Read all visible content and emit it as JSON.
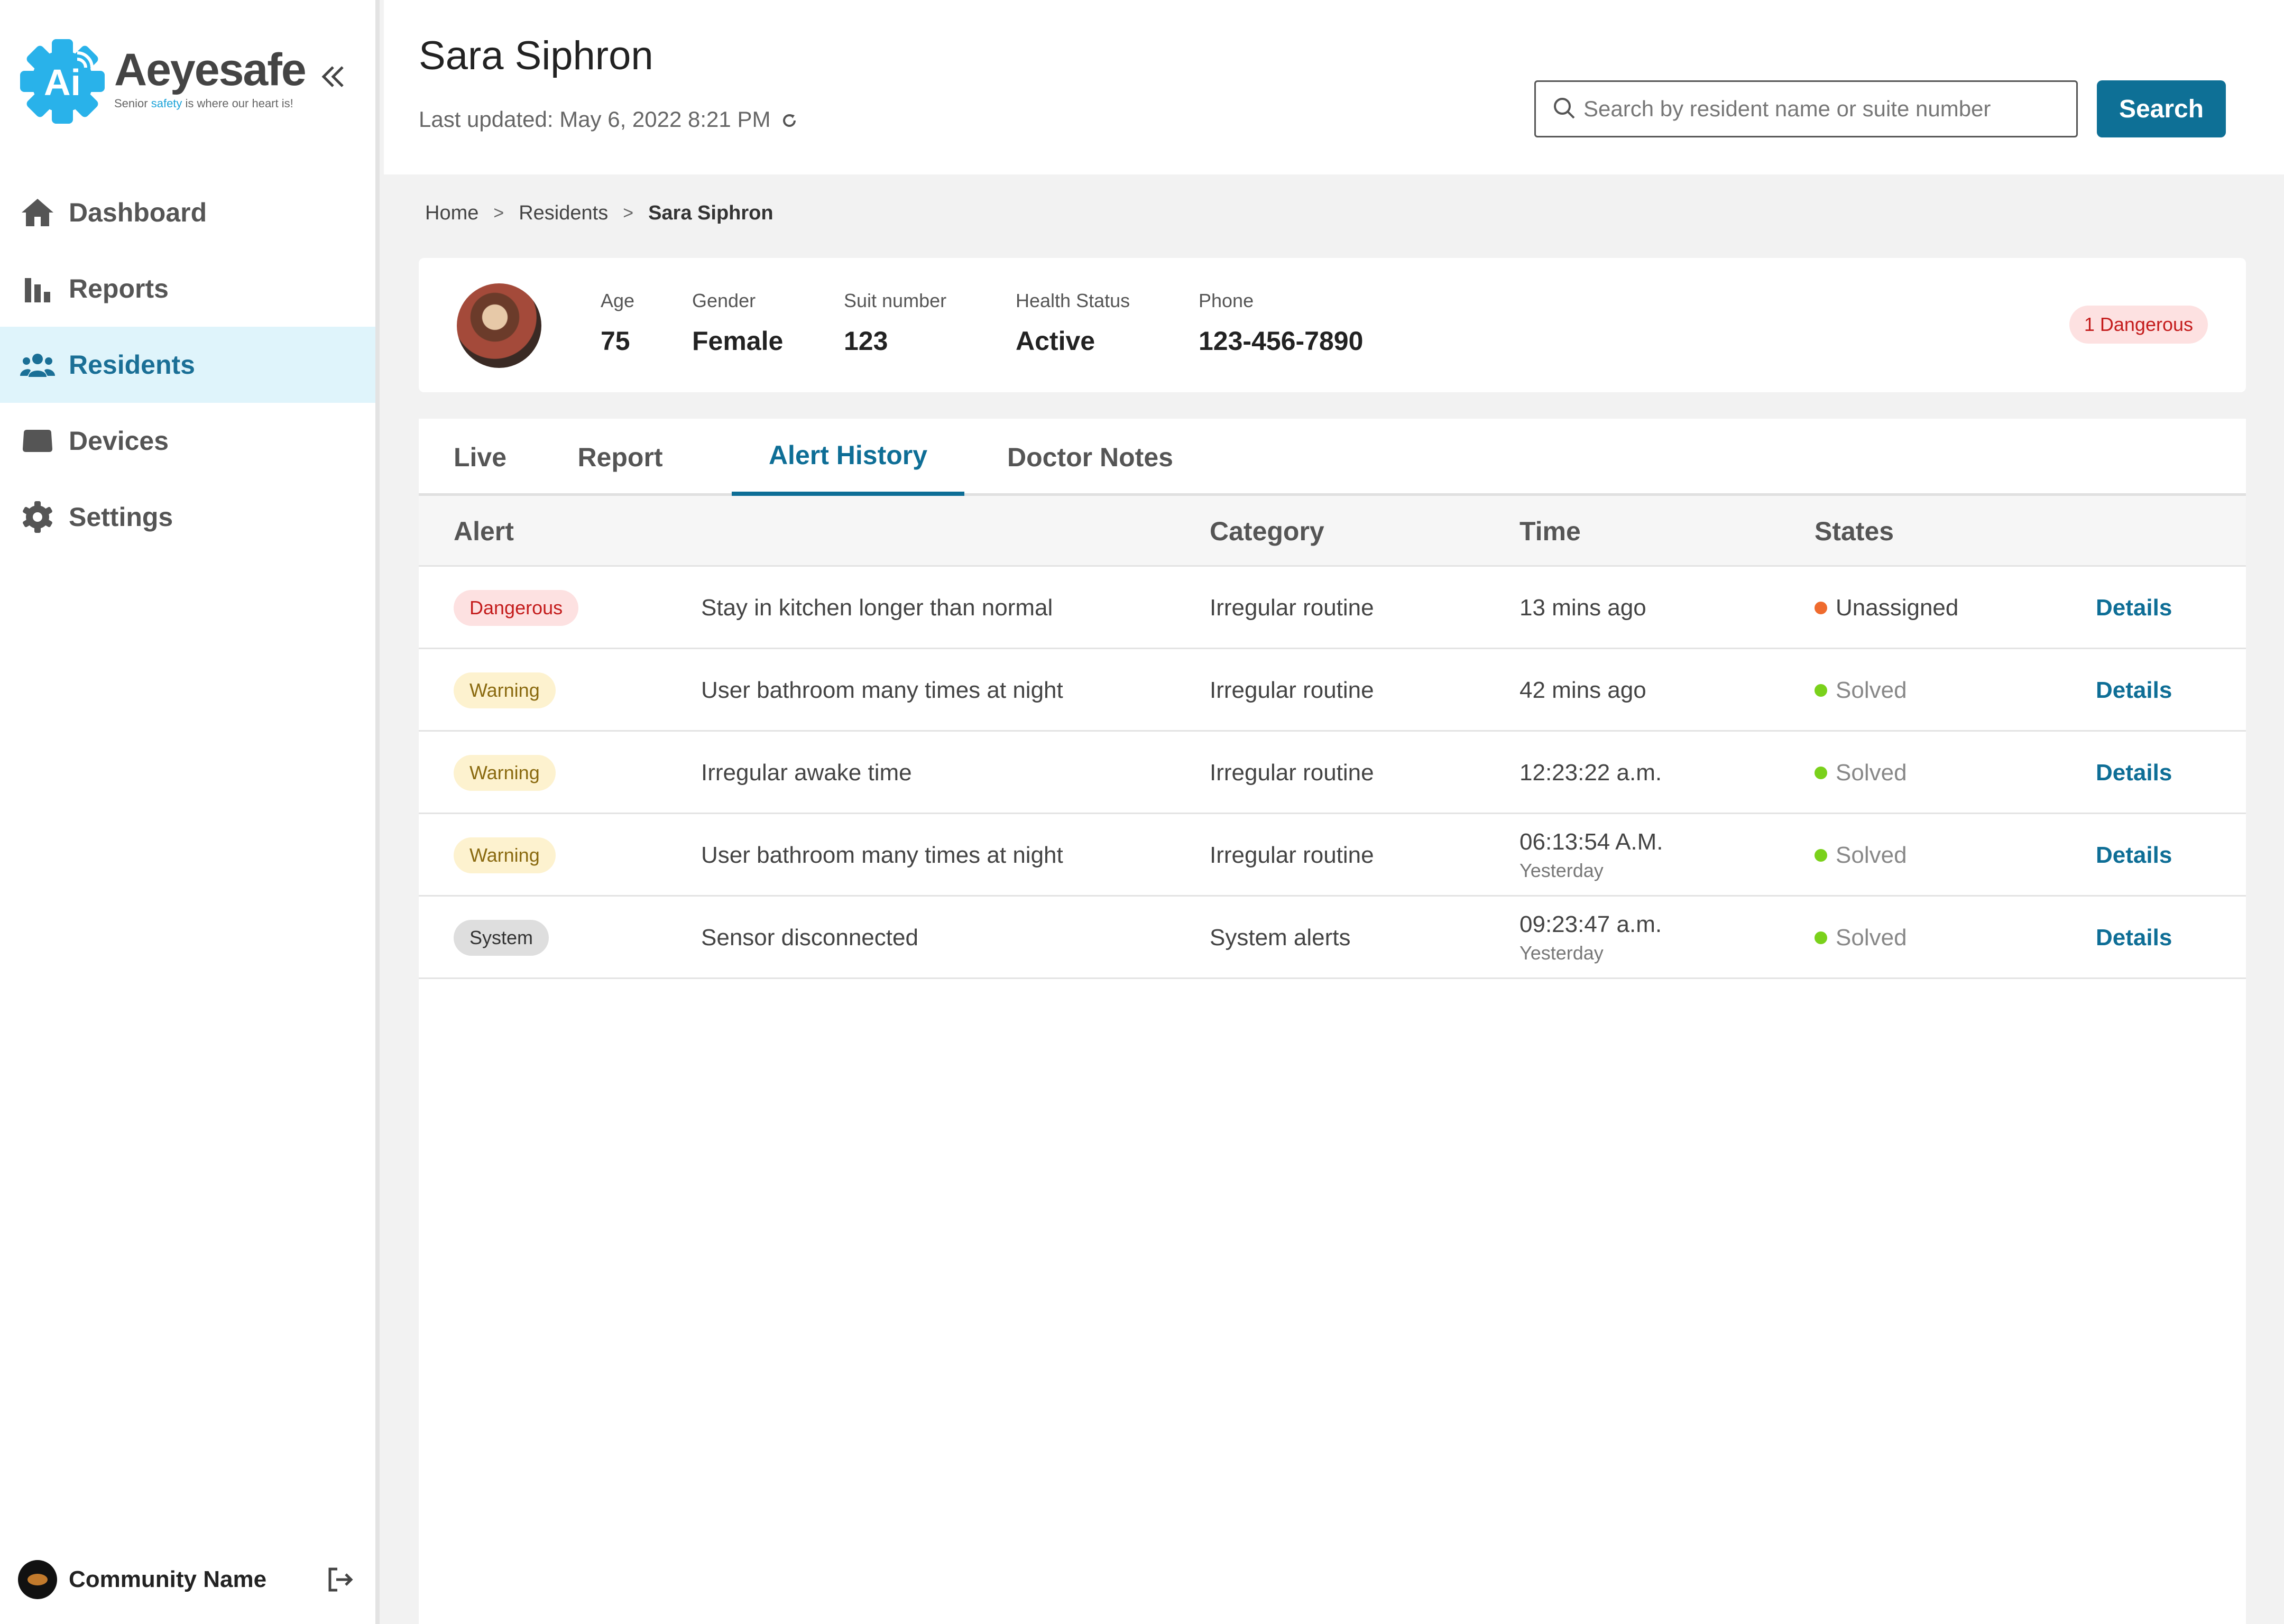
{
  "brand": {
    "name": "Aeyesafe",
    "mark_text": "Ai",
    "tagline_pre": "Senior ",
    "tagline_hl": "safety",
    "tagline_post": " is where our heart is!"
  },
  "sidebar": {
    "items": [
      {
        "label": "Dashboard",
        "icon": "home-icon",
        "active": false
      },
      {
        "label": "Reports",
        "icon": "bar-chart-icon",
        "active": false
      },
      {
        "label": "Residents",
        "icon": "people-icon",
        "active": true
      },
      {
        "label": "Devices",
        "icon": "device-icon",
        "active": false
      },
      {
        "label": "Settings",
        "icon": "gear-icon",
        "active": false
      }
    ],
    "community_name": "Community Name"
  },
  "header": {
    "title": "Sara Siphron",
    "last_updated": "Last updated: May 6, 2022 8:21 PM",
    "search_placeholder": "Search by resident name or suite number",
    "search_button": "Search"
  },
  "breadcrumb": [
    "Home",
    "Residents",
    "Sara Siphron"
  ],
  "profile": {
    "age_label": "Age",
    "age": "75",
    "gender_label": "Gender",
    "gender": "Female",
    "suit_label": "Suit number",
    "suit": "123",
    "health_label": "Health Status",
    "health": "Active",
    "phone_label": "Phone",
    "phone": "123-456-7890",
    "danger_badge": "1 Dangerous"
  },
  "tabs": [
    "Live",
    "Report",
    "Alert History",
    "Doctor Notes"
  ],
  "active_tab": "Alert History",
  "table": {
    "headers": {
      "alert": "Alert",
      "category": "Category",
      "time": "Time",
      "states": "States"
    },
    "rows": [
      {
        "level": "Dangerous",
        "level_type": "dangerous",
        "description": "Stay in kitchen longer than normal",
        "category": "Irregular routine",
        "time": "13 mins ago",
        "time_sub": "",
        "state": "Unassigned",
        "state_type": "unassigned",
        "action": "Details"
      },
      {
        "level": "Warning",
        "level_type": "warning",
        "description": "User bathroom many times at night",
        "category": "Irregular routine",
        "time": "42 mins ago",
        "time_sub": "",
        "state": "Solved",
        "state_type": "solved",
        "action": "Details"
      },
      {
        "level": "Warning",
        "level_type": "warning",
        "description": "Irregular awake time",
        "category": "Irregular routine",
        "time": "12:23:22 a.m.",
        "time_sub": "",
        "state": "Solved",
        "state_type": "solved",
        "action": "Details"
      },
      {
        "level": "Warning",
        "level_type": "warning",
        "description": "User bathroom many times at night",
        "category": "Irregular routine",
        "time": "06:13:54 A.M.",
        "time_sub": "Yesterday",
        "state": "Solved",
        "state_type": "solved",
        "action": "Details"
      },
      {
        "level": "System",
        "level_type": "system",
        "description": "Sensor disconnected",
        "category": "System alerts",
        "time": "09:23:47 a.m.",
        "time_sub": "Yesterday",
        "state": "Solved",
        "state_type": "solved",
        "action": "Details"
      }
    ]
  },
  "colors": {
    "accent": "#0e7096",
    "active_nav_bg": "#dff4fb",
    "logo_blue": "#29b2ea"
  }
}
